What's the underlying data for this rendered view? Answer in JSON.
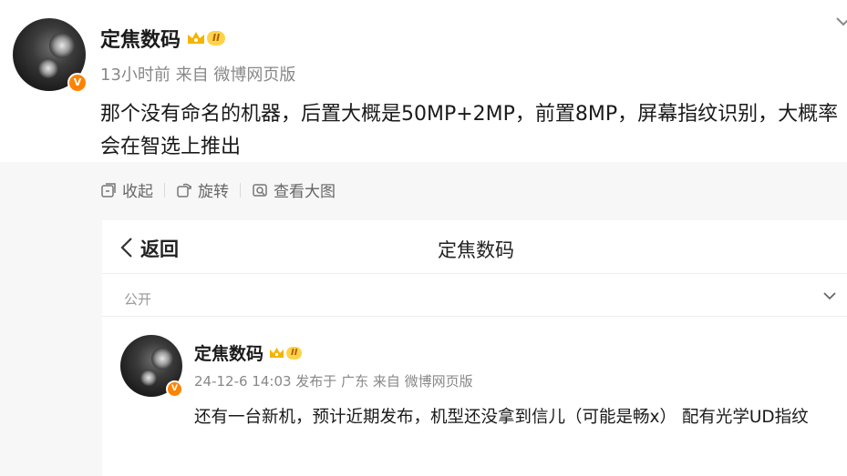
{
  "post": {
    "author": "定焦数码",
    "badge_text": "II",
    "meta": "13小时前 来自 微博网页版",
    "text": "那个没有命名的机器，后置大概是50MP+2MP，前置8MP，屏幕指纹识别，大概率会在智选上推出",
    "verified_mark": "V"
  },
  "toolbar": {
    "collapse_label": "收起",
    "rotate_label": "旋转",
    "view_large_label": "查看大图"
  },
  "screenshot": {
    "back_label": "返回",
    "header_title": "定焦数码",
    "visibility_label": "公开",
    "author": "定焦数码",
    "badge_text": "II",
    "meta": "24-12-6 14:03 发布于 广东 来自 微博网页版",
    "text": "还有一台新机，预计近期发布，机型还没拿到信儿（可能是畅x） 配有光学UD指纹",
    "verified_mark": "V"
  },
  "colors": {
    "accent_orange": "#ff8200",
    "crown_gold": "#f5b400"
  }
}
